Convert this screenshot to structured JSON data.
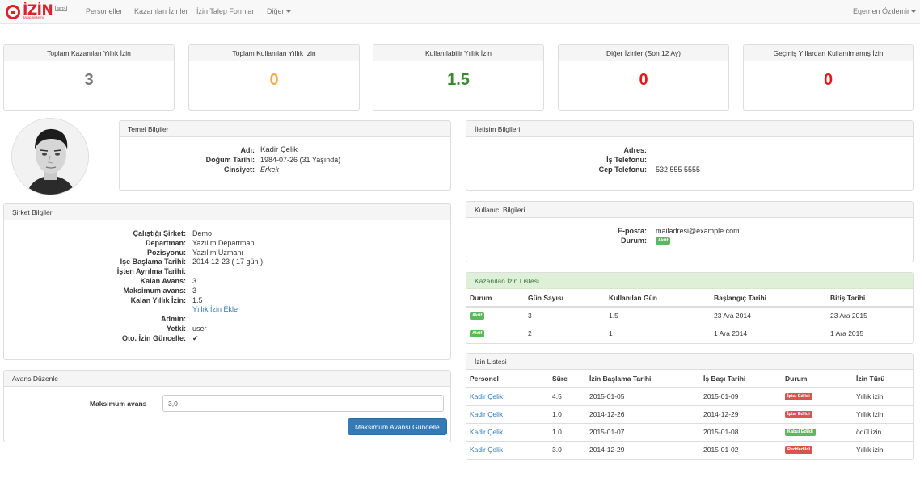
{
  "navbar": {
    "logo_text": "İZİN",
    "logo_sub": "takip sistemi",
    "logo_badge": "BETA",
    "items": [
      "Personeller",
      "Kazanılan İzinler",
      "İzin Talep Formları",
      "Diğer"
    ],
    "user": "Egemen Özdemir"
  },
  "stats": [
    {
      "label": "Toplam Kazanılan Yıllık İzin",
      "value": "3",
      "color": "#777777"
    },
    {
      "label": "Toplam Kullanılan Yıllık İzin",
      "value": "0",
      "color": "#f0ad4e"
    },
    {
      "label": "Kullanılabilir Yıllık İzin",
      "value": "1.5",
      "color": "#3c8a2f"
    },
    {
      "label": "Diğer İzinler (Son 12 Ay)",
      "value": "0",
      "color": "#e01b1b"
    },
    {
      "label": "Geçmiş Yıllardan Kullanılmamış İzin",
      "value": "0",
      "color": "#e01b1b"
    }
  ],
  "basic": {
    "title": "Temel Bilgiler",
    "name_label": "Adı:",
    "name": "Kadir Çelik",
    "dob_label": "Doğum Tarihi:",
    "dob": "1984-07-26 (31 Yaşında)",
    "gender_label": "Cinsiyet:",
    "gender": "Erkek"
  },
  "contact": {
    "title": "İletişim Bilgileri",
    "address_label": "Adres:",
    "address": "",
    "work_phone_label": "İş Telefonu:",
    "work_phone": "",
    "mobile_label": "Cep Telefonu:",
    "mobile": "532 555 5555"
  },
  "user_info": {
    "title": "Kullanıcı Bilgileri",
    "email_label": "E-posta:",
    "email": "mailadresi@example.com",
    "status_label": "Durum:",
    "status": "Aktif"
  },
  "company": {
    "title": "Şirket Bilgileri",
    "rows": [
      {
        "label": "Çalıştığı Şirket:",
        "value": "Demo"
      },
      {
        "label": "Departman:",
        "value": "Yazılım Departmanı"
      },
      {
        "label": "Pozisyonu:",
        "value": "Yazılım Uzmanı"
      },
      {
        "label": "İşe Başlama Tarihi:",
        "value": "2014-12-23 ( 17 gün )"
      },
      {
        "label": "İşten Ayrılma Tarihi:",
        "value": ""
      },
      {
        "label": "Kalan Avans:",
        "value": "3"
      },
      {
        "label": "Maksimum avans:",
        "value": "3"
      },
      {
        "label": "Kalan Yıllık İzin:",
        "value": "1.5"
      },
      {
        "label": "",
        "value": "Yıllık İzin Ekle"
      },
      {
        "label": "Admin:",
        "value": ""
      },
      {
        "label": "Yetki:",
        "value": "user"
      },
      {
        "label": "Oto. İzin Güncelle:",
        "value": "✔"
      }
    ]
  },
  "advance": {
    "title": "Avans Düzenle",
    "label": "Maksimum avans",
    "value": "3,0",
    "button": "Maksimum Avansı Güncelle"
  },
  "earned": {
    "title": "Kazanılan İzin Listesi",
    "headers": [
      "Durum",
      "Gün Sayısı",
      "Kullanılan Gün",
      "Başlangıç Tarihi",
      "Bitiş Tarihi"
    ],
    "rows": [
      {
        "status": "Aktif",
        "days": "3",
        "used": "1.5",
        "start": "23 Ara 2014",
        "end": "23 Ara 2015"
      },
      {
        "status": "Aktif",
        "days": "2",
        "used": "1",
        "start": "1 Ara 2014",
        "end": "1 Ara 2015"
      }
    ]
  },
  "leaves": {
    "title": "İzin Listesi",
    "headers": [
      "Personel",
      "Süre",
      "İzin Başlama Tarihi",
      "İş Başı Tarihi",
      "Durum",
      "İzin Türü"
    ],
    "rows": [
      {
        "person": "Kadir Çelik",
        "duration": "4.5",
        "start": "2015-01-05",
        "return": "2015-01-09",
        "status": "İptal Edildi",
        "status_color": "#d9534f",
        "type": "Yıllık izin"
      },
      {
        "person": "Kadir Çelik",
        "duration": "1.0",
        "start": "2014-12-26",
        "return": "2014-12-29",
        "status": "İptal Edildi",
        "status_color": "#d9534f",
        "type": "Yıllık izin"
      },
      {
        "person": "Kadir Çelik",
        "duration": "1.0",
        "start": "2015-01-07",
        "return": "2015-01-08",
        "status": "Kabul Edildi",
        "status_color": "#5cb85c",
        "type": "ödül izin"
      },
      {
        "person": "Kadir Çelik",
        "duration": "3.0",
        "start": "2014-12-29",
        "return": "2015-01-02",
        "status": "Reddedildi",
        "status_color": "#d9534f",
        "type": "Yıllık izin"
      }
    ]
  }
}
